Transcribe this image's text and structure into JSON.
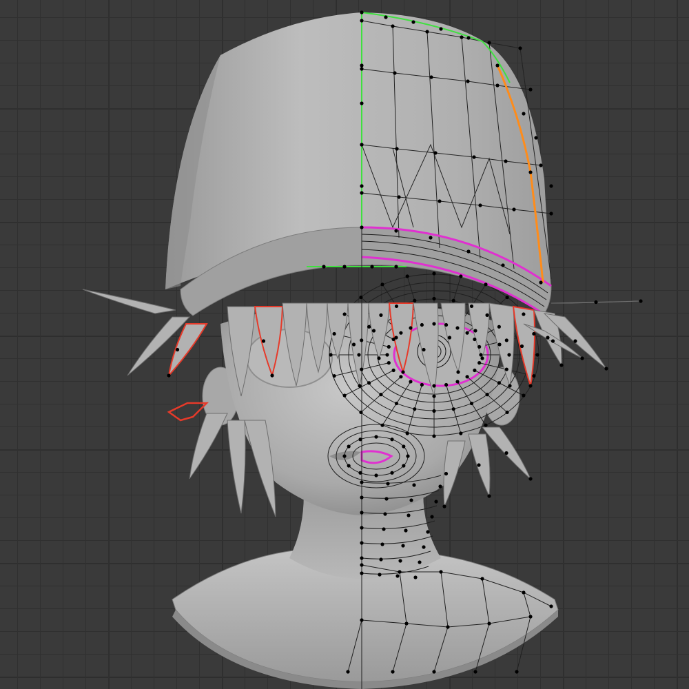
{
  "viewport": {
    "mode": "edit-mode-mesh",
    "background_color": "#3a3a3a",
    "grid_color": "#303030"
  },
  "model": {
    "name": "anime-head-with-bucket-hat",
    "surface_color": "#b4b4b4",
    "wire_color": "#1a1a1a",
    "vertex_color": "#000000"
  },
  "selection_colors": {
    "seam": "#e63a2a",
    "selected_edge": "#ff8c1a",
    "selected_face_outline": "#e030d0",
    "center_loop": "#40e040"
  },
  "mirror_axis": "x"
}
